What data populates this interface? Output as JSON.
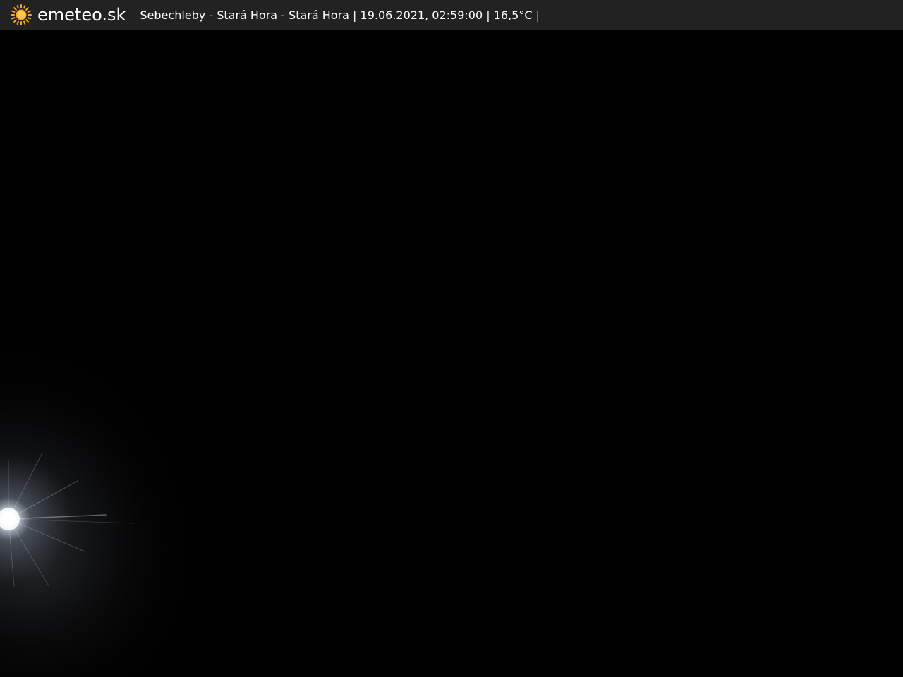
{
  "header": {
    "brand": "emeteo.sk",
    "caption": "Sebechleby - Stará Hora - Stará Hora | 19.06.2021, 02:59:00 | 16,5°C |",
    "logo_icon": "sun-icon",
    "logo_color": "#f5a623"
  },
  "scene": {
    "description_color_sky": "#010101",
    "light_color": "#ffffff"
  }
}
